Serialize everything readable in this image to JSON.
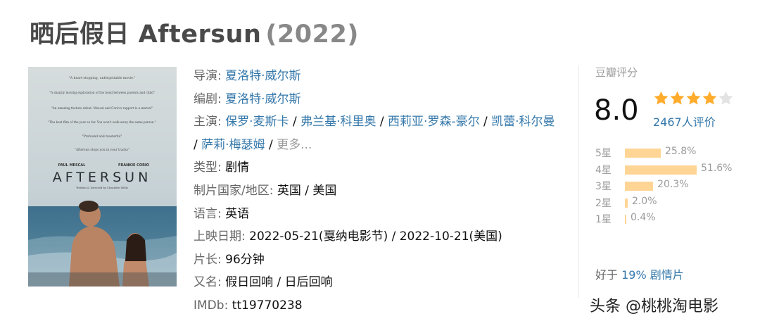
{
  "header": {
    "title": "晒后假日 Aftersun",
    "year": "(2022)"
  },
  "poster": {
    "quotes": [
      "\"A heart-stopping, unforgettable movie.\"",
      "\"A sharply moving exploration of the bond between parents and child\"",
      "\"An amazing feature debut. Mescal and Corio's rapport is a marvel\"",
      "\"The best film of the year so far. You won't walk away the same person.\"",
      "\"Profound and masterful\"",
      "\"Aftersun stops you in your tracks\""
    ],
    "actor_left": "PAUL MESCAL",
    "actor_right": "FRANKIE CORIO",
    "film_title": "AFTERSUN",
    "credit": "Written & Directed by Charlotte Wells"
  },
  "info": {
    "director_label": "导演",
    "director": "夏洛特·威尔斯",
    "writer_label": "编剧",
    "writer": "夏洛特·威尔斯",
    "cast_label": "主演",
    "cast": [
      "保罗·麦斯卡",
      "弗兰基·科里奥",
      "西莉亚·罗森-豪尔",
      "凯蕾·科尔曼",
      "萨莉·梅瑟姆"
    ],
    "more": "更多...",
    "genre_label": "类型",
    "genre": "剧情",
    "country_label": "制片国家/地区",
    "country": "英国 / 美国",
    "language_label": "语言",
    "language": "英语",
    "release_label": "上映日期",
    "release": "2022-05-21(戛纳电影节) / 2022-10-21(美国)",
    "runtime_label": "片长",
    "runtime": "96分钟",
    "aka_label": "又名",
    "aka": "假日回响 / 日后回响",
    "imdb_label": "IMDb",
    "imdb": "tt19770238"
  },
  "rating": {
    "title": "豆瓣评分",
    "score": "8.0",
    "stars": 4,
    "votes": "2467人评价",
    "distribution": [
      {
        "label": "5星",
        "percent_text": "25.8%",
        "percent": 25.8
      },
      {
        "label": "4星",
        "percent_text": "51.6%",
        "percent": 51.6
      },
      {
        "label": "3星",
        "percent_text": "20.3%",
        "percent": 20.3
      },
      {
        "label": "2星",
        "percent_text": "2.0%",
        "percent": 2.0
      },
      {
        "label": "1星",
        "percent_text": "0.4%",
        "percent": 0.4
      }
    ],
    "better_prefix": "好于",
    "better_link": "19% 剧情片"
  },
  "watermark": "头条 @桃桃淘电影",
  "colors": {
    "link": "#3377aa",
    "bar": "#ffd596",
    "star_on": "#ffac2d",
    "star_off": "#e3e3e3"
  }
}
